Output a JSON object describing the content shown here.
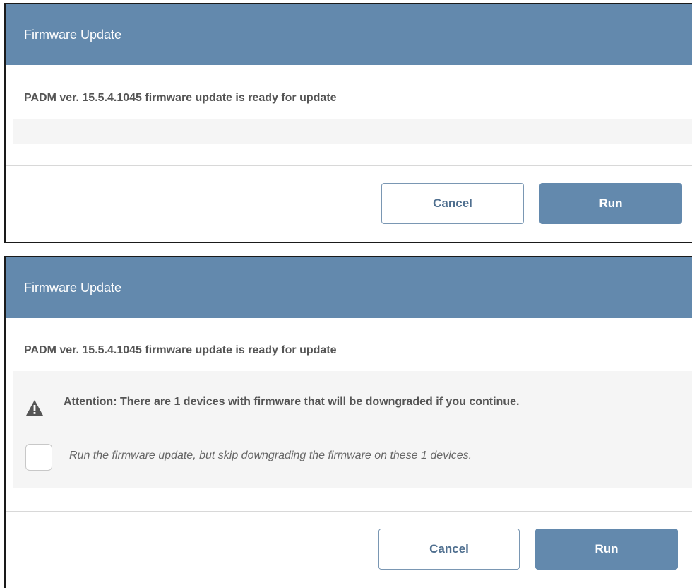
{
  "dialog_ready": {
    "title": "Firmware Update",
    "message": "PADM ver. 15.5.4.1045 firmware update is ready for update",
    "cancel_label": "Cancel",
    "run_label": "Run"
  },
  "dialog_downgrade": {
    "title": "Firmware Update",
    "message": "PADM ver. 15.5.4.1045 firmware update is ready for update",
    "warning": {
      "icon": "warning-triangle-icon",
      "text": "Attention: There are 1 devices with firmware that will be downgraded if you continue."
    },
    "skip_downgrade_checkbox": {
      "label": "Run the firmware update, but skip downgrading the firmware on these 1 devices.",
      "checked": false
    },
    "cancel_label": "Cancel",
    "run_label": "Run"
  },
  "colors": {
    "header": "#6389ad",
    "primary_button": "#6389ad",
    "panel_background": "#f5f5f5"
  }
}
